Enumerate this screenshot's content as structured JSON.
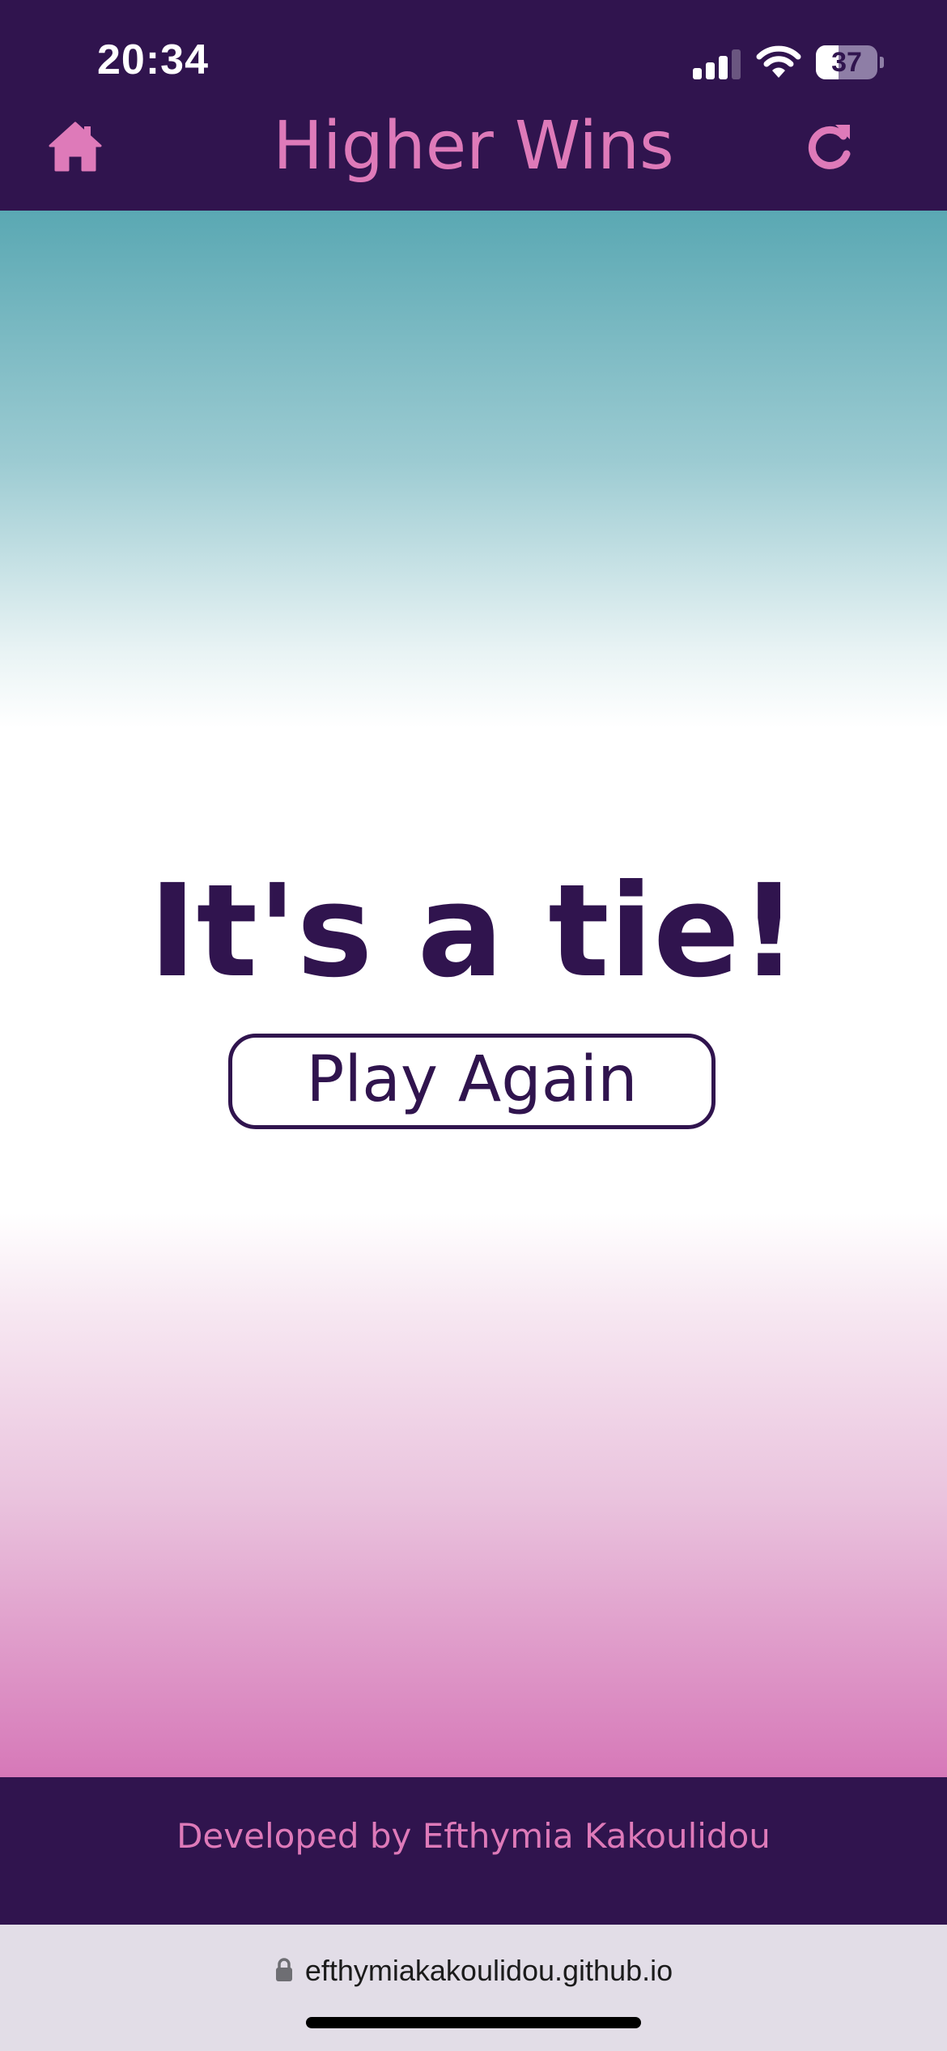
{
  "status_bar": {
    "time": "20:34",
    "battery_level": "37",
    "battery_fraction": 0.37,
    "icons": [
      "cellular-signal-icon",
      "wifi-icon",
      "battery-icon"
    ]
  },
  "app_bar": {
    "title": "Higher Wins",
    "home_icon": "home-icon",
    "refresh_icon": "refresh-icon"
  },
  "game": {
    "result": "It's a tie!",
    "play_again_label": "Play Again"
  },
  "footer": {
    "credit": "Developed by Efthymia Kakoulidou"
  },
  "browser": {
    "url": "efthymiakakoulidou.github.io",
    "lock_icon": "lock-icon"
  },
  "colors": {
    "primary_dark": "#30144e",
    "accent_pink": "#de7ab9",
    "teal": "#5aa8b3",
    "url_bar_bg": "#e2dde7"
  }
}
